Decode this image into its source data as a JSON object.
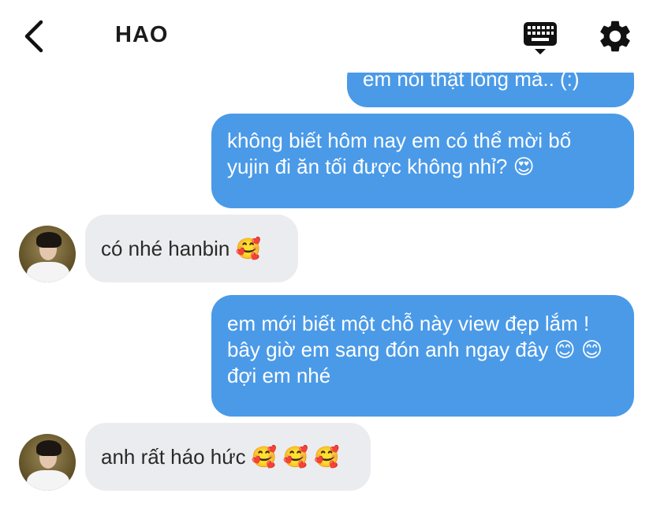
{
  "header": {
    "title": "HAO"
  },
  "messages": [
    {
      "direction": "out",
      "text": "em nói thật lòng mà.. (:)"
    },
    {
      "direction": "out",
      "text": "không biết hôm nay em có thể mời bố yujin đi ăn tối được không nhỉ? 😍"
    },
    {
      "direction": "in",
      "text": "có nhé hanbin 🥰"
    },
    {
      "direction": "out",
      "text": "em mới biết một chỗ này view đẹp lắm ! bây giờ em sang đón anh ngay đây 😊 😊  đợi em nhé"
    },
    {
      "direction": "in",
      "text": "anh rất háo hức 🥰 🥰 🥰"
    }
  ],
  "colors": {
    "outgoing_bubble": "#4a9ae8",
    "incoming_bubble": "#ebecef",
    "title": "#1b1b1b"
  },
  "icons": [
    "back-chevron-icon",
    "keyboard-icon",
    "gear-icon"
  ]
}
